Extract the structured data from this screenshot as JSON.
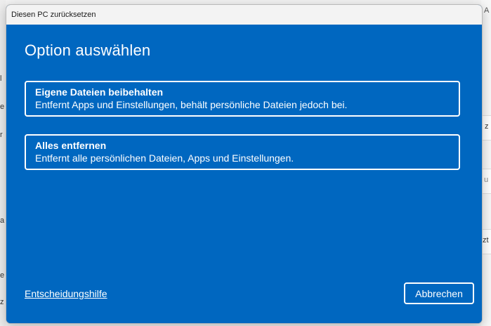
{
  "window": {
    "title": "Diesen PC zurücksetzen"
  },
  "dialog": {
    "heading": "Option auswählen",
    "options": [
      {
        "title": "Eigene Dateien beibehalten",
        "description": "Entfernt Apps und Einstellungen, behält persönliche Dateien jedoch bei."
      },
      {
        "title": "Alles entfernen",
        "description": "Entfernt alle persönlichen Dateien, Apps und Einstellungen."
      }
    ],
    "help_link": "Entscheidungshilfe",
    "cancel_label": "Abbrechen"
  },
  "background": {
    "left_fragments": [
      "l",
      "e",
      "r",
      "a",
      "e",
      "z"
    ],
    "right_fragments": [
      "A",
      "z",
      "u",
      "zt"
    ]
  },
  "colors": {
    "dialog_accent": "#0067c0",
    "titlebar": "#f3f3f3",
    "text_on_accent": "#ffffff"
  }
}
